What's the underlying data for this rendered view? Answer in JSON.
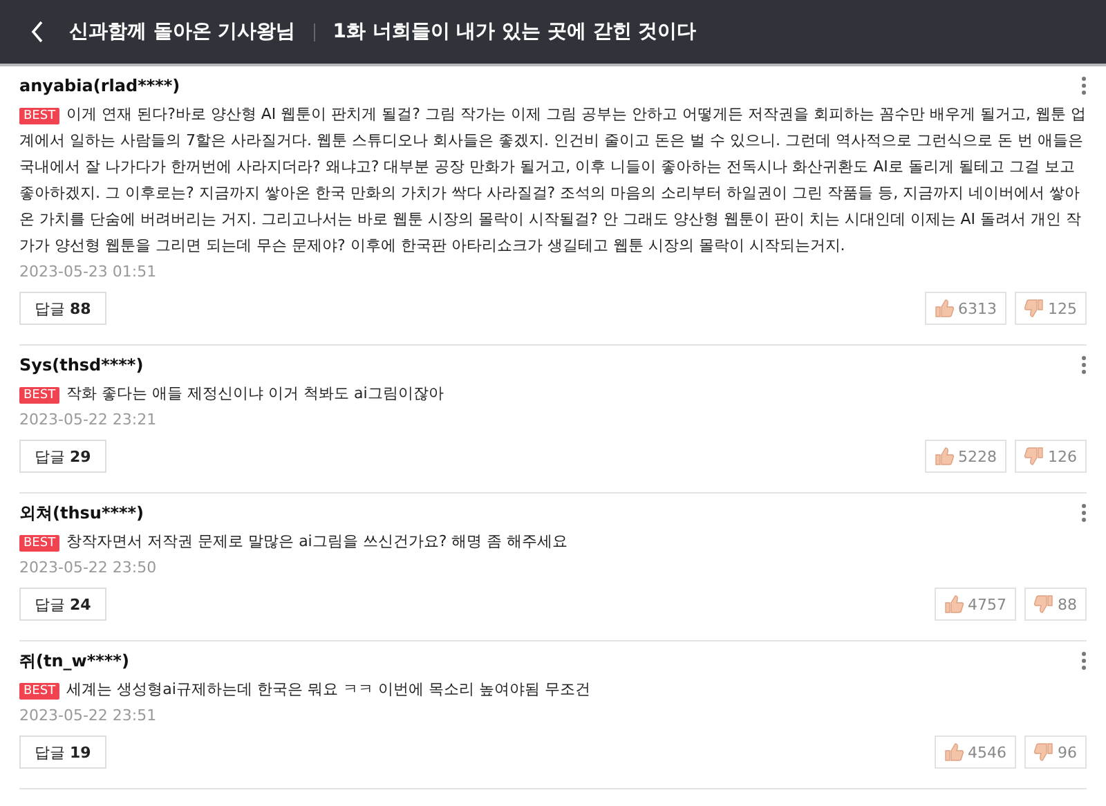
{
  "header": {
    "title": "신과함께 돌아온 기사왕님",
    "episode": "1화 너희들이 내가 있는 곳에 갇힌 것이다"
  },
  "comments": [
    {
      "author": "anyabia(rlad****)",
      "badge": "BEST",
      "text": "이게 연재 된다?바로 양산형 AI 웹툰이 판치게 될걸? 그림 작가는 이제 그림 공부는 안하고 어떻게든 저작권을 회피하는 꼼수만 배우게 될거고, 웹툰 업계에서 일하는 사람들의 7할은 사라질거다. 웹툰 스튜디오나 회사들은 좋겠지. 인건비 줄이고 돈은 벌 수 있으니. 그런데 역사적으로 그런식으로 돈 번 애들은 국내에서 잘 나가다가 한꺼번에 사라지더라? 왜냐고? 대부분 공장 만화가 될거고, 이후 니들이 좋아하는 전독시나 화산귀환도 AI로 돌리게 될테고 그걸 보고 좋아하겠지. 그 이후로는? 지금까지 쌓아온 한국 만화의 가치가 싹다 사라질걸? 조석의 마음의 소리부터 하일권이 그린 작품들 등, 지금까지 네이버에서 쌓아온 가치를 단숨에 버려버리는 거지. 그리고나서는 바로 웹툰 시장의 몰락이 시작될걸? 안 그래도 양산형 웹툰이 판이 치는 시대인데 이제는 AI 돌려서 개인 작가가 양선형 웹툰을 그리면 되는데 무슨 문제야? 이후에 한국판 아타리쇼크가 생길테고 웹툰 시장의 몰락이 시작되는거지.",
      "date": "2023-05-23 01:51",
      "reply_label": "답글",
      "replies": "88",
      "likes": "6313",
      "dislikes": "125"
    },
    {
      "author": "Sys(thsd****)",
      "badge": "BEST",
      "text": "작화 좋다는 애들 제정신이냐 이거 척봐도 ai그림이잖아",
      "date": "2023-05-22 23:21",
      "reply_label": "답글",
      "replies": "29",
      "likes": "5228",
      "dislikes": "126"
    },
    {
      "author": "외쳐(thsu****)",
      "badge": "BEST",
      "text": "창작자면서 저작권 문제로 말많은 ai그림을 쓰신건가요? 해명 좀 해주세요",
      "date": "2023-05-22 23:50",
      "reply_label": "답글",
      "replies": "24",
      "likes": "4757",
      "dislikes": "88"
    },
    {
      "author": "쥐(tn_w****)",
      "badge": "BEST",
      "text": "세계는 생성형ai규제하는데 한국은 뭐요 ㅋㅋ 이번에 목소리 높여야됨 무조건",
      "date": "2023-05-22 23:51",
      "reply_label": "답글",
      "replies": "19",
      "likes": "4546",
      "dislikes": "96"
    }
  ]
}
